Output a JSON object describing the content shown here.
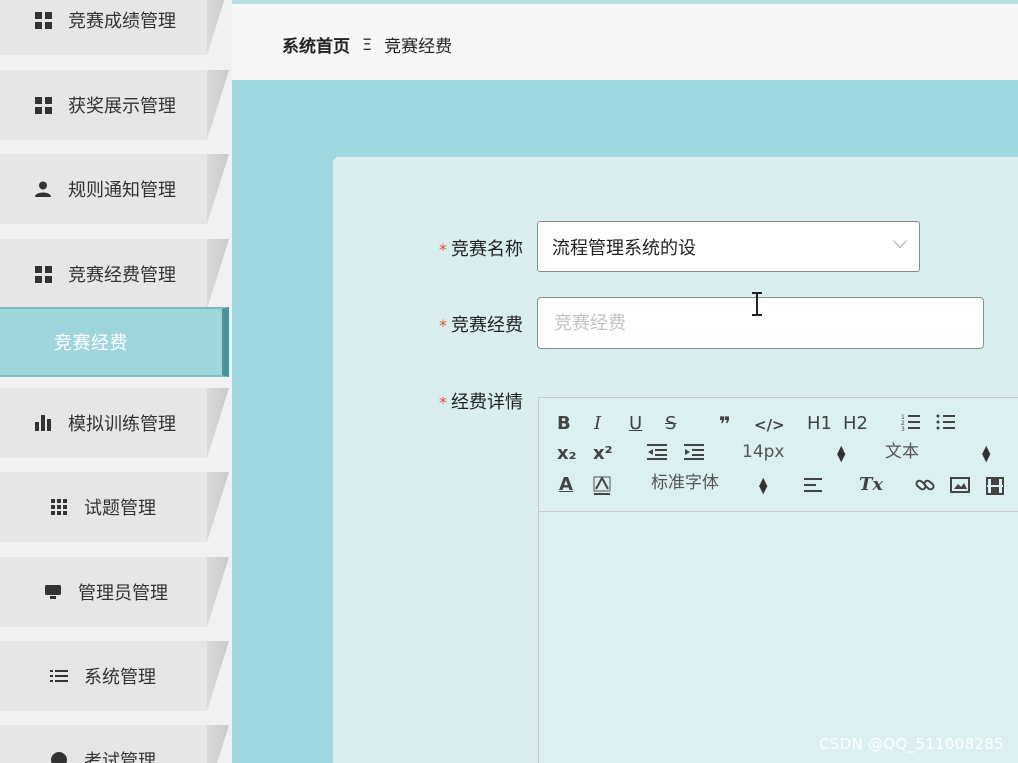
{
  "sidebar": {
    "items": [
      {
        "label": "竞赛成绩管理",
        "icon": "grid-icon"
      },
      {
        "label": "获奖展示管理",
        "icon": "grid-icon"
      },
      {
        "label": "规则通知管理",
        "icon": "user-icon"
      },
      {
        "label": "竞赛经费管理",
        "icon": "grid-icon"
      },
      {
        "label": "模拟训练管理",
        "icon": "bar-chart-icon"
      },
      {
        "label": "试题管理",
        "icon": "grid-nine-icon"
      },
      {
        "label": "管理员管理",
        "icon": "monitor-icon"
      },
      {
        "label": "系统管理",
        "icon": "list-icon"
      },
      {
        "label": "考试管理",
        "icon": "pie-icon"
      }
    ],
    "submenu_active": "竞赛经费"
  },
  "header": {
    "breadcrumb_home": "系统首页",
    "breadcrumb_sep": "Ξ",
    "breadcrumb_current": "竞赛经费"
  },
  "form": {
    "required_mark": "*",
    "name_label": "竞赛名称",
    "name_value": "流程管理系统的设",
    "fee_label": "竞赛经费",
    "fee_placeholder": "竞赛经费",
    "detail_label": "经费详情"
  },
  "editor": {
    "bold": "B",
    "italic": "I",
    "underline": "U",
    "strike": "S",
    "quote": "❞",
    "code": "</>",
    "h1": "H1",
    "h2": "H2",
    "subscript": "x₂",
    "superscript": "x²",
    "size_value": "14px",
    "header_value": "文本",
    "font_value": "标准字体",
    "clean": "Tx",
    "font_color": "A"
  },
  "watermark": "CSDN @QQ_511008285"
}
